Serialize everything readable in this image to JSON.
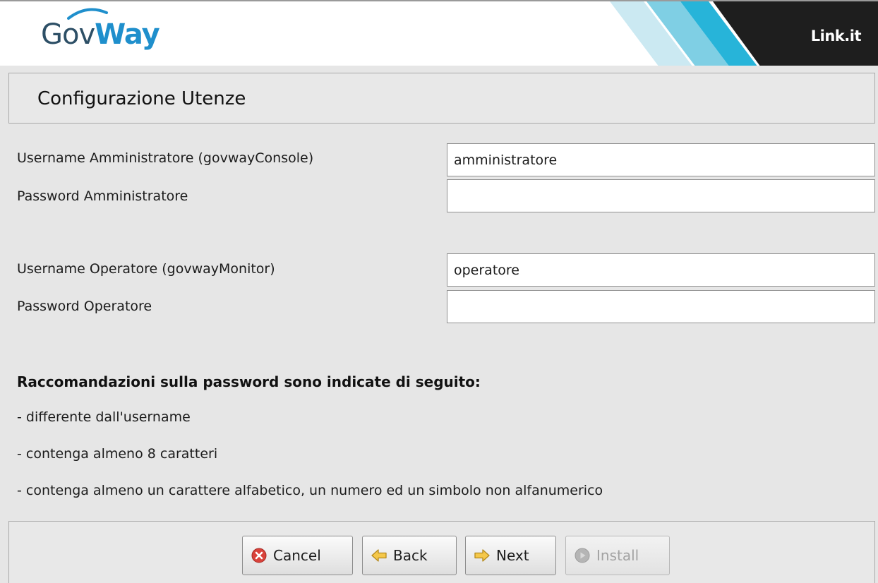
{
  "header": {
    "logo_part1": "Gov",
    "logo_part2": "Way",
    "brand": "Link.it"
  },
  "section_title": "Configurazione Utenze",
  "form": {
    "admin_username_label": "Username Amministratore (govwayConsole)",
    "admin_username_value": "amministratore",
    "admin_password_label": "Password Amministratore",
    "admin_password_value": "",
    "operator_username_label": "Username Operatore (govwayMonitor)",
    "operator_username_value": "operatore",
    "operator_password_label": "Password Operatore",
    "operator_password_value": ""
  },
  "recommendations": {
    "title": "Raccomandazioni sulla password sono indicate di seguito:",
    "items": [
      "- differente dall'username",
      "- contenga almeno 8 caratteri",
      "- contenga almeno un carattere alfabetico, un numero ed un simbolo non alfanumerico"
    ]
  },
  "buttons": {
    "cancel": "Cancel",
    "back": "Back",
    "next": "Next",
    "install": "Install"
  },
  "colors": {
    "logo_dark": "#2d4f66",
    "logo_accent": "#1f8fcc",
    "brand_bg": "#1e1e1e",
    "stripe_light": "#cbe9f2",
    "stripe_mid": "#7fcfe4",
    "stripe_strong": "#27b4d9",
    "cancel_icon": "#d9423b",
    "arrow_icon": "#f5c84a"
  },
  "icons": {
    "cancel": "cancel-x-icon",
    "back": "arrow-left-icon",
    "next": "arrow-right-icon",
    "install": "install-disc-icon"
  }
}
